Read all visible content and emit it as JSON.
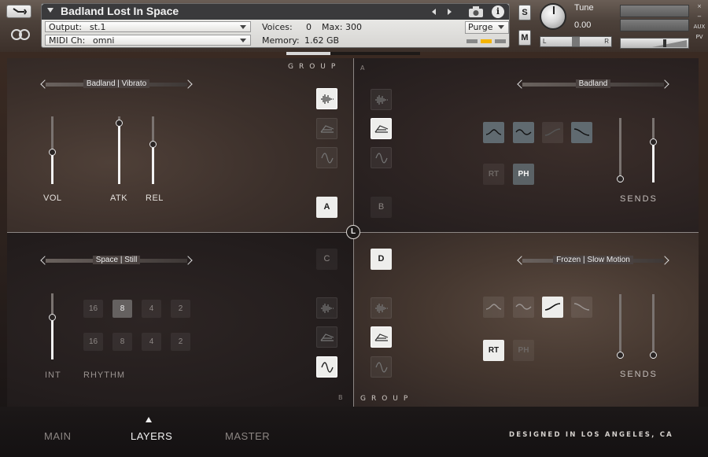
{
  "header": {
    "instrument_title": "Badland Lost In Space",
    "output_label": "Output:",
    "output_value": "st.1",
    "voices_label": "Voices:",
    "voices_value": "0",
    "max_label": "Max:",
    "max_value": "300",
    "purge_label": "Purge",
    "midi_label": "MIDI Ch:",
    "midi_value": "omni",
    "memory_label": "Memory:",
    "memory_value": "1.62 GB",
    "solo_label": "S",
    "mute_label": "M",
    "tune_label": "Tune",
    "tune_value": "0.00",
    "pan_left": "L",
    "pan_right": "R",
    "aux_label": "AUX",
    "pv_label": "PV",
    "close_glyph": "×",
    "minimize_glyph": "−"
  },
  "quadrant_a": {
    "group_label": "GROUP",
    "letter": "A",
    "preset": "Badland | Vibrato",
    "vol_label": "VOL",
    "atk_label": "ATK",
    "rel_label": "REL",
    "vol_level": 0.47,
    "atk_level": 0.95,
    "rel_level": 0.6,
    "button_label": "A"
  },
  "quadrant_b": {
    "preset": "Badland",
    "button_label": "B",
    "rt_label": "RT",
    "ph_label": "PH",
    "sends_label": "SENDS",
    "send1_level": 0.0,
    "send2_level": 0.65
  },
  "quadrant_c": {
    "preset": "Space | Still",
    "button_label": "C",
    "int_label": "INT",
    "rhythm_label": "RHYTHM",
    "int_level": 0.65,
    "rhythm_row1": [
      "16",
      "8",
      "4",
      "2"
    ],
    "rhythm_row2": [
      "16",
      "8",
      "4",
      "2"
    ],
    "letter": "B"
  },
  "quadrant_d": {
    "group_label": "GROUP",
    "preset": "Frozen | Slow Motion",
    "button_label": "D",
    "rt_label": "RT",
    "ph_label": "PH",
    "sends_label": "SENDS",
    "send1_level": 0.0,
    "send2_level": 0.0
  },
  "center_label": "L",
  "footer": {
    "tabs": [
      "MAIN",
      "LAYERS",
      "MASTER"
    ],
    "active_tab": "LAYERS",
    "designed": "DESIGNED IN LOS ANGELES, CA"
  },
  "colors": {
    "accent_white": "#eeeeec",
    "active_button": "#606a70",
    "led_orange": "#f5b400"
  }
}
